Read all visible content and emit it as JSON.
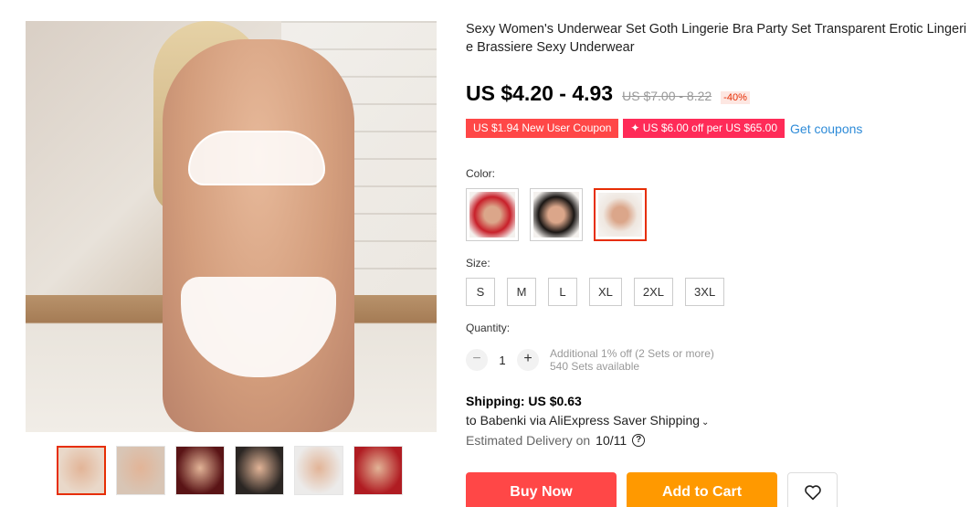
{
  "product": {
    "title": "Sexy Women's Underwear Set Goth Lingerie Bra Party Set Transparent Erotic Lingerie Brassiere Sexy Underwear",
    "price": "US $4.20 - 4.93",
    "original_price": "US $7.00 - 8.22",
    "discount": "-40%"
  },
  "coupons": {
    "new_user": "US $1.94 New User Coupon",
    "store": "✦ US $6.00 off per US $65.00",
    "get_label": "Get coupons"
  },
  "color": {
    "label": "Color:",
    "options": [
      {
        "name": "red-lace",
        "swatch": "#c8202a"
      },
      {
        "name": "black-lace",
        "swatch": "#1a1614"
      },
      {
        "name": "white-strappy",
        "swatch": "#efe7e0"
      }
    ],
    "selected_index": 2
  },
  "size": {
    "label": "Size:",
    "options": [
      "S",
      "M",
      "L",
      "XL",
      "2XL",
      "3XL"
    ]
  },
  "quantity": {
    "label": "Quantity:",
    "minus": "−",
    "value": "1",
    "plus": "+",
    "note1": "Additional 1% off (2 Sets or more)",
    "note2": "540 Sets available"
  },
  "shipping": {
    "cost": "Shipping: US $0.63",
    "route": "to Babenki via AliExpress Saver Shipping",
    "chevron": "⌄",
    "delivery_label": "Estimated Delivery on",
    "delivery_date": "10/11",
    "help": "?"
  },
  "actions": {
    "buy": "Buy Now",
    "cart": "Add to Cart"
  },
  "thumbnails": [
    {
      "swatch": "#e9d8c9",
      "active": true
    },
    {
      "swatch": "#d8c5b5",
      "active": false
    },
    {
      "swatch": "#5a1416",
      "active": false
    },
    {
      "swatch": "#2b2623",
      "active": false
    },
    {
      "swatch": "#ecebea",
      "active": false
    },
    {
      "swatch": "#b01c22",
      "active": false
    }
  ],
  "colors": {
    "accent": "#e62e04",
    "buy": "#ff4747",
    "cart": "#ff9900",
    "link": "#2e8bd8"
  }
}
